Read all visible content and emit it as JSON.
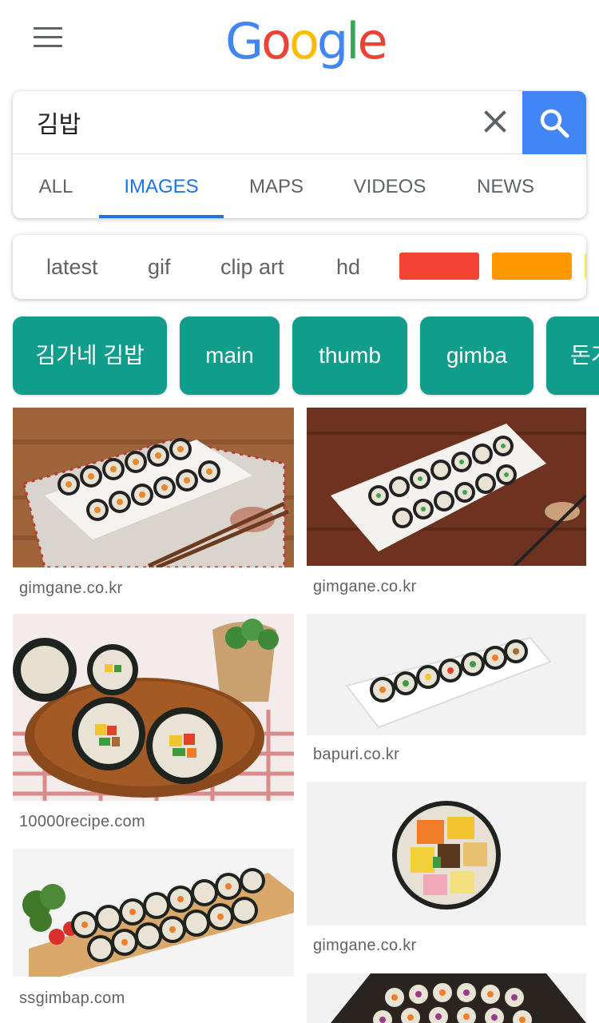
{
  "header": {
    "logo_letters": [
      "G",
      "o",
      "o",
      "g",
      "l",
      "e"
    ],
    "logo_colors": [
      "#4285f4",
      "#ea4335",
      "#fbbc05",
      "#4285f4",
      "#34a853",
      "#ea4335"
    ]
  },
  "search": {
    "query": "김밥",
    "placeholder": ""
  },
  "tabs": [
    {
      "label": "ALL"
    },
    {
      "label": "IMAGES",
      "active": true
    },
    {
      "label": "MAPS"
    },
    {
      "label": "VIDEOS"
    },
    {
      "label": "NEWS"
    }
  ],
  "filters": [
    {
      "label": "latest"
    },
    {
      "label": "gif"
    },
    {
      "label": "clip art"
    },
    {
      "label": "hd"
    }
  ],
  "color_filters": [
    "#f44336",
    "#ff9800",
    "#ffeb3b"
  ],
  "chips": [
    {
      "label": "김가네 김밥"
    },
    {
      "label": "main"
    },
    {
      "label": "thumb"
    },
    {
      "label": "gimba"
    },
    {
      "label": "돈가"
    }
  ],
  "results": [
    {
      "source": "gimgane.co.kr"
    },
    {
      "source": "gimgane.co.kr"
    },
    {
      "source": "10000recipe.com"
    },
    {
      "source": "bapuri.co.kr"
    },
    {
      "source": "ssgimbap.com"
    },
    {
      "source": "gimgane.co.kr"
    },
    {
      "source": ""
    }
  ],
  "colors": {
    "accent": "#1a73e8",
    "search_button": "#4285f4",
    "chip": "#109d8c"
  }
}
